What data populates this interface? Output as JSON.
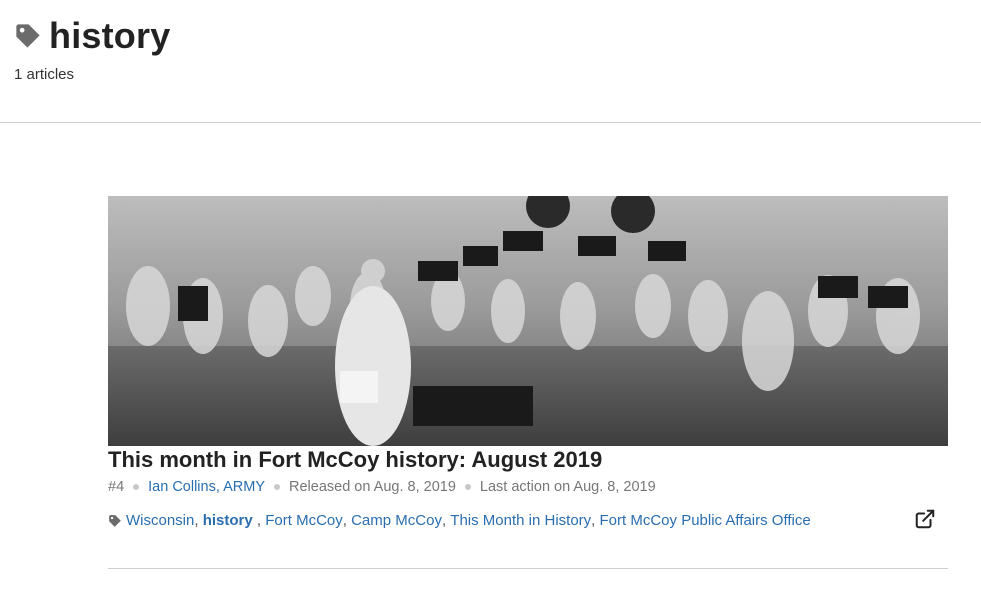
{
  "header": {
    "title": "history",
    "article_count": "1 articles"
  },
  "article": {
    "title": "This month in Fort McCoy history: August 2019",
    "number": "#4",
    "author": "Ian Collins, ARMY",
    "released": "Released on Aug. 8, 2019",
    "last_action": "Last action on Aug. 8, 2019",
    "tags": [
      {
        "label": "Wisconsin",
        "sep": ", "
      },
      {
        "label": "history",
        "sep": " , ",
        "current": true
      },
      {
        "label": "Fort McCoy",
        "sep": ", "
      },
      {
        "label": "Camp McCoy",
        "sep": ", "
      },
      {
        "label": "This Month in History",
        "sep": ", "
      },
      {
        "label": "Fort McCoy Public Affairs Office",
        "sep": ""
      }
    ]
  },
  "colors": {
    "link": "#2a6eb0",
    "icon": "#666666",
    "divider": "#cfcfcf"
  },
  "icons": [
    "tag-icon",
    "external-link-icon"
  ]
}
